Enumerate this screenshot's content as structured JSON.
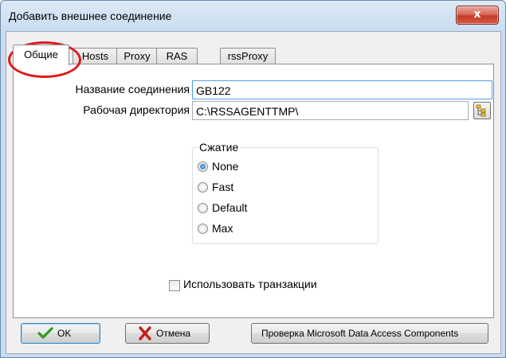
{
  "window": {
    "title": "Добавить внешнее соединение",
    "close_glyph": "x"
  },
  "tabs": [
    {
      "label": "Общие",
      "active": true
    },
    {
      "label": "Hosts",
      "active": false
    },
    {
      "label": "Proxy",
      "active": false
    },
    {
      "label": "RAS",
      "active": false
    },
    {
      "label": "rssProxy",
      "active": false
    }
  ],
  "general": {
    "name_label": "Название соединения",
    "name_value": "GB122",
    "workdir_label": "Рабочая директория",
    "workdir_value": "C:\\RSSAGENTTMP\\",
    "browse_icon": "folder-tree-icon",
    "compression": {
      "title": "Сжатие",
      "options": [
        {
          "label": "None",
          "checked": true
        },
        {
          "label": "Fast",
          "checked": false
        },
        {
          "label": "Default",
          "checked": false
        },
        {
          "label": "Max",
          "checked": false
        }
      ]
    },
    "use_transactions_label": "Использовать транзакции",
    "use_transactions_checked": false
  },
  "buttons": {
    "ok_label": "OK",
    "ok_icon": "checkmark-icon",
    "cancel_label": "Отмена",
    "cancel_icon": "cross-icon",
    "mdac_label": "Проверка Microsoft Data Access Components"
  },
  "colors": {
    "annotation": "#e0191b",
    "close_button": "#c23a29",
    "ok_check": "#2f9a1f",
    "cancel_cross": "#c21f16"
  }
}
